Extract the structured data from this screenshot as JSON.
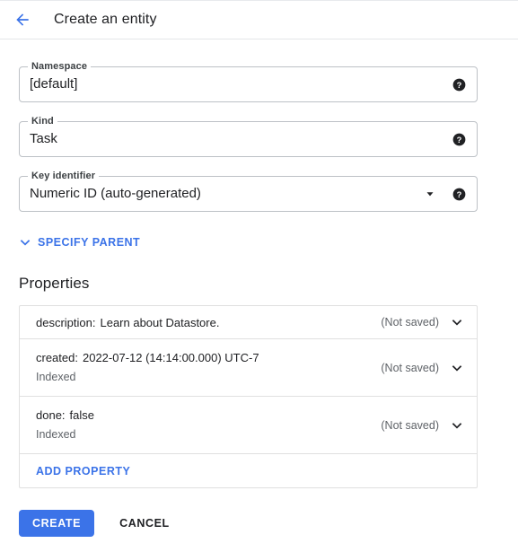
{
  "header": {
    "back_icon": "arrow-left-icon",
    "title": "Create an entity",
    "accent_color": "#3b73e8"
  },
  "form": {
    "fields": [
      {
        "name": "namespace",
        "legend": "Namespace",
        "value": "[default]",
        "help_icon": "help-icon",
        "type": "text"
      },
      {
        "name": "kind",
        "legend": "Kind",
        "value": "Task",
        "help_icon": "help-icon",
        "type": "text"
      },
      {
        "name": "key-identifier",
        "legend": "Key identifier",
        "value": "Numeric ID (auto-generated)",
        "help_icon": "help-icon",
        "caret_icon": "chevron-down-icon",
        "type": "select"
      }
    ]
  },
  "specify_parent": {
    "label": "SPECIFY PARENT",
    "icon": "chevron-down-icon"
  },
  "properties": {
    "section_title": "Properties",
    "rows": [
      {
        "key": "description:",
        "value": "Learn about Datastore.",
        "sub": "",
        "status": "(Not saved)",
        "icon": "chevron-down-icon"
      },
      {
        "key": "created:",
        "value": "2022-07-12 (14:14:00.000) UTC-7",
        "sub": "Indexed",
        "status": "(Not saved)",
        "icon": "chevron-down-icon"
      },
      {
        "key": "done:",
        "value": "false",
        "sub": "Indexed",
        "status": "(Not saved)",
        "icon": "chevron-down-icon"
      }
    ],
    "add_property_label": "ADD PROPERTY"
  },
  "actions": {
    "create_label": "CREATE",
    "cancel_label": "CANCEL"
  }
}
